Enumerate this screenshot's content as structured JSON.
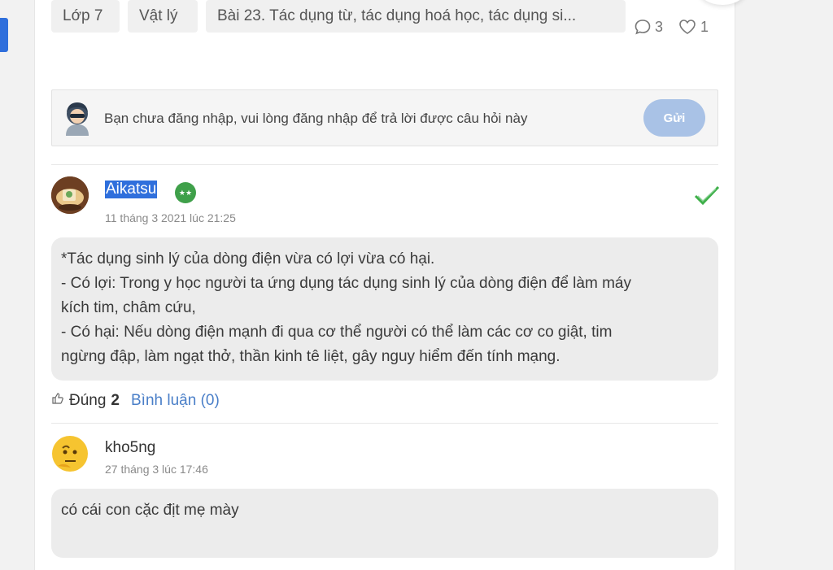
{
  "tags": [
    "Lớp 7",
    "Vật lý",
    "Bài 23. Tác dụng từ, tác dụng hoá học, tác dụng si..."
  ],
  "meta": {
    "comments": "3",
    "likes": "1"
  },
  "login_prompt": {
    "text": "Bạn chưa đăng nhập, vui lòng đăng nhập để trả lời được câu hỏi này",
    "button": "Gửi"
  },
  "answers": [
    {
      "user": "Aikatsu",
      "time": "11 tháng 3 2021 lúc 21:25",
      "lines": [
        "*Tác dụng sinh lý của dòng điện vừa có lợi vừa có hại.",
        "- Có lợi: Trong y học người ta ứng dụng tác dụng sinh lý của dòng điện để làm máy",
        "kích tim, châm cứu,",
        "- Có hại: Nếu dòng điện mạnh đi qua cơ thể người có thể làm các cơ co giật, tim",
        "ngừng đập, làm ngạt thở, thần kinh tê liệt, gây nguy hiểm đến tính mạng."
      ],
      "like_label": "Đúng",
      "like_count": "2",
      "comment_link": "Bình luận (0)"
    },
    {
      "user": "kho5ng",
      "time": "27 tháng 3 lúc 17:46",
      "lines": [
        "có cái con cặc địt mẹ mày"
      ]
    }
  ],
  "colors": {
    "accent": "#2f6fdc",
    "send_button": "#a9c2e6",
    "check": "#3fb04a",
    "link": "#4a7fc8"
  }
}
